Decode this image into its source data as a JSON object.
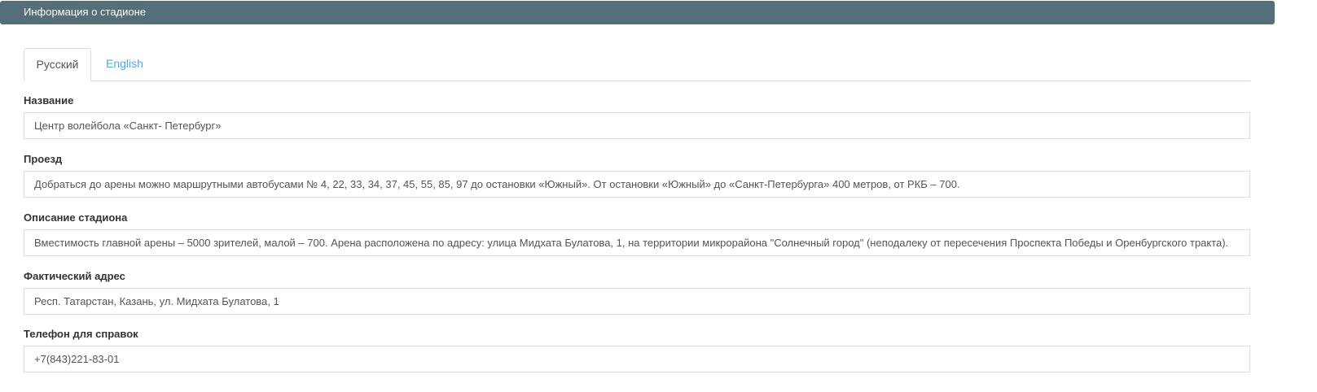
{
  "panel": {
    "title": "Информация о стадионе"
  },
  "tabs": [
    {
      "label": "Русский",
      "active": true
    },
    {
      "label": "English",
      "active": false
    }
  ],
  "fields": {
    "name": {
      "label": "Название",
      "value": "Центр волейбола «Санкт- Петербург»"
    },
    "directions": {
      "label": "Проезд",
      "value": "Добраться до арены можно маршрутными автобусами № 4, 22, 33, 34, 37, 45, 55, 85, 97 до остановки «Южный». От остановки «Южный» до «Санкт-Петербурга» 400 метров, от РКБ – 700."
    },
    "description": {
      "label": "Описание стадиона",
      "value": "Вместимость главной арены – 5000 зрителей, малой – 700. Арена расположена по адресу: улица Мидхата Булатова, 1, на территории микрорайона \"Солнечный город\" (неподалеку от пересечения Проспекта Победы и Оренбургского тракта)."
    },
    "address": {
      "label": "Фактический адрес",
      "value": "Респ. Татарстан, Казань, ул. Мидхата Булатова, 1"
    },
    "phone": {
      "label": "Телефон для справок",
      "value": "+7(843)221-83-01"
    }
  },
  "colors": {
    "header_bg": "#546e7a",
    "tab_link": "#4fa9d8",
    "border": "#dddddd"
  }
}
